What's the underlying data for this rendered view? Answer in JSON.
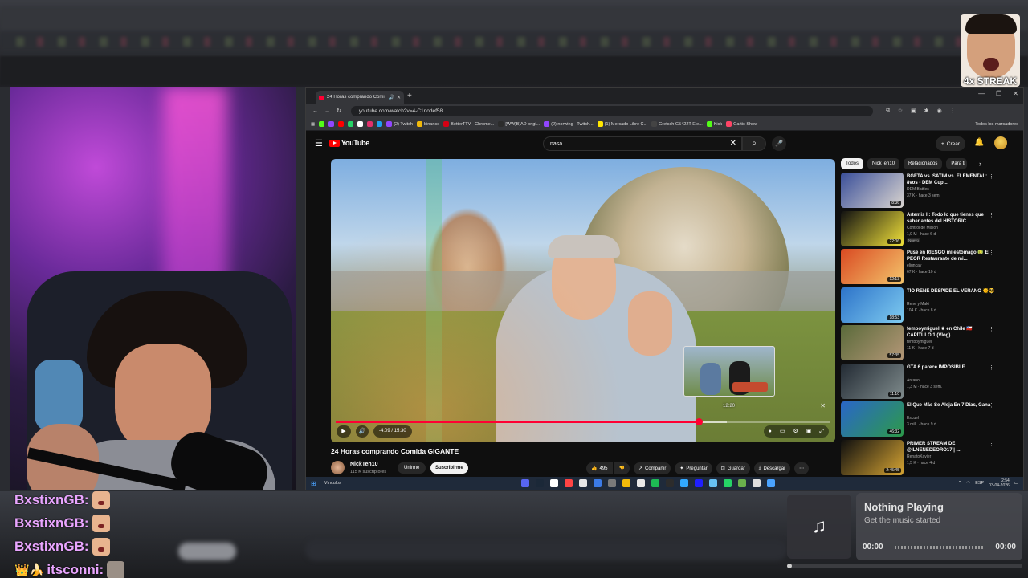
{
  "overlay": {
    "streak_label": "4x STREAK",
    "chat": [
      {
        "user": "BxstixnGB:",
        "color": "#e9a5ff",
        "badge": ""
      },
      {
        "user": "BxstixnGB:",
        "color": "#e9a5ff",
        "badge": ""
      },
      {
        "user": "BxstixnGB:",
        "color": "#e9a5ff",
        "badge": ""
      },
      {
        "user": "itsconni:",
        "color": "#e9a5ff",
        "badge": "👑🍌"
      }
    ],
    "music": {
      "icon": "♫",
      "title": "Nothing Playing",
      "subtitle": "Get the music started",
      "time_current": "00:00",
      "time_total": "00:00"
    }
  },
  "browser": {
    "tab_title": "24 Horas comprando Comi",
    "url": "youtube.com/watch?v=4-C1nodef58",
    "bookmarks": [
      {
        "label": "",
        "color": "#53fc18"
      },
      {
        "label": "",
        "color": "#9146ff"
      },
      {
        "label": "",
        "color": "#ff0000"
      },
      {
        "label": "",
        "color": "#25d366"
      },
      {
        "label": "",
        "color": "#ffffff"
      },
      {
        "label": "",
        "color": "#e1306c"
      },
      {
        "label": "",
        "color": "#1da1f2"
      },
      {
        "label": "(2) Twitch",
        "color": "#9146ff"
      },
      {
        "label": "binance",
        "color": "#f0b90b"
      },
      {
        "label": "BetterTTV - Chrome...",
        "color": "#d50014"
      },
      {
        "label": "[WW]B]AD origi...",
        "color": "#2c2c2c"
      },
      {
        "label": "(2) norwing - Twitch...",
        "color": "#9146ff"
      },
      {
        "label": "(1) Mercado Libre C...",
        "color": "#ffe600"
      },
      {
        "label": "Gretsch G5422T Ele...",
        "color": "#444444"
      },
      {
        "label": "Kick",
        "color": "#53fc18"
      },
      {
        "label": "Gartic Show",
        "color": "#ff4466"
      }
    ],
    "all_bookmarks": "Todos los marcadores"
  },
  "youtube": {
    "logo_text": "YouTube",
    "search_value": "nasa",
    "create_label": "Crear",
    "player": {
      "time_label": "-4:09 / 15:30",
      "preview_time": "12:20",
      "progress_fraction": 0.734,
      "buffered_fraction": 0.79
    },
    "video_title": "24 Horas comprando Comida GIGANTE",
    "channel": {
      "name": "NickTen10",
      "subs": "115 K suscriptores",
      "join_label": "Unirme",
      "subscribe_label": "Suscribirme"
    },
    "actions": {
      "likes": "495",
      "share": "Compartir",
      "ask": "Preguntar",
      "save": "Guardar",
      "download": "Descargar"
    },
    "chips": [
      "Todos",
      "NickTen10",
      "Relacionados",
      "Para ti"
    ],
    "recommendations": [
      {
        "title": "BGETA vs. SATIM vs. ELEMENTAL: 8vos - DEM Cup...",
        "channel": "DEM Battles",
        "meta": "37 K · hace 3 sem.",
        "duration": "8:36",
        "badge": "",
        "c1": "#3a4f9a",
        "c2": "#d9d4cf"
      },
      {
        "title": "Artemis II: Todo lo que tienes que saber antes del HISTÓRIC...",
        "channel": "Control de Misión",
        "meta": "1,9 M · hace 6 d",
        "duration": "22:06",
        "badge": "Nuevo",
        "c1": "#111111",
        "c2": "#f2e23a"
      },
      {
        "title": "Puse en RIESGO mi estómago 🤢 El PEOR Restaurante de mi...",
        "channel": "eljuncay",
        "meta": "67 K · hace 10 d",
        "duration": "12:13",
        "badge": "",
        "c1": "#d94a22",
        "c2": "#f4c46b"
      },
      {
        "title": "TIO RENE DESPIDE EL VERANO 🌞😎",
        "channel": "Rene y Maki",
        "meta": "104 K · hace 8 d",
        "duration": "18:53",
        "badge": "",
        "c1": "#2d73c9",
        "c2": "#7ecbf0"
      },
      {
        "title": "femboymiguel ⚜ en Chile 🇨🇱 CAPÍTULO 1 (Vlog)",
        "channel": "femboymiguel",
        "meta": "11 K · hace 7 d",
        "duration": "57:35",
        "badge": "",
        "c1": "#5a6a3a",
        "c2": "#b49777"
      },
      {
        "title": "GTA 6 parece IMPOSIBLE",
        "channel": "Arcano",
        "meta": "1,3 M · hace 3 sem.",
        "duration": "11:10",
        "badge": "",
        "c1": "#222a33",
        "c2": "#7f8b8c"
      },
      {
        "title": "El Que Más Se Aleja En 7 Días, Gana",
        "channel": "Escuel",
        "meta": "3 mill. · hace 9 d",
        "duration": "46:32",
        "badge": "",
        "c1": "#2a66c9",
        "c2": "#2c9a4a"
      },
      {
        "title": "PRIMER STREAM DE @ILNENEDEORO17 | ...",
        "channel": "RenatoXavier",
        "meta": "1,5 K · hace 4 d",
        "duration": "2:45:45",
        "badge": "",
        "c1": "#0f0f0f",
        "c2": "#d6a433"
      }
    ]
  },
  "taskbar": {
    "search": "Vínculos",
    "lang": "ESP",
    "time": "2:54",
    "date": "03-04-2026",
    "icons": [
      "#5865f2",
      "#1b2838",
      "#ffffff",
      "#ff4444",
      "#e6e6e6",
      "#3b7be8",
      "#7a7a7a",
      "#f0b90b",
      "#e8e8e8",
      "#1db954",
      "#2c2c2c",
      "#31a8ff",
      "#1f1fff",
      "#66c0f4",
      "#25d366",
      "#6ab04c",
      "#dddddd",
      "#4aa3ff"
    ]
  }
}
